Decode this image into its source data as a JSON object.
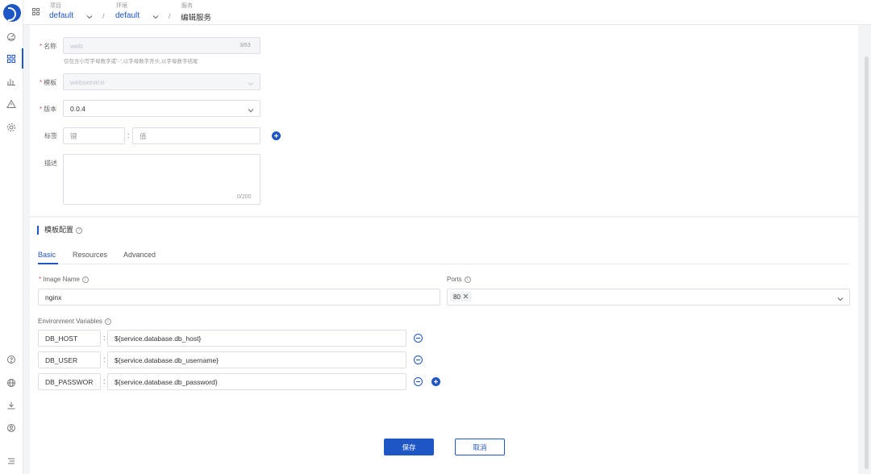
{
  "breadcrumb": {
    "project": {
      "caption": "项目",
      "value": "default"
    },
    "env": {
      "caption": "环境",
      "value": "default"
    },
    "service": {
      "caption": "服务",
      "value": "编辑服务"
    },
    "separator": "/"
  },
  "form": {
    "name": {
      "label": "名称",
      "value": "web",
      "counter": "3/63",
      "hint": "仅包含小写字母数字或\"-\",以字母数字开头,以字母数字结尾"
    },
    "template": {
      "label": "模板",
      "value": "webservice"
    },
    "version": {
      "label": "版本",
      "value": "0.0.4"
    },
    "tags": {
      "label": "标签",
      "key_placeholder": "键",
      "value_placeholder": "值",
      "colon": ":"
    },
    "description": {
      "label": "描述",
      "counter": "0/200"
    }
  },
  "template_config": {
    "title": "模板配置",
    "tabs": [
      "Basic",
      "Resources",
      "Advanced"
    ],
    "image_name": {
      "label": "Image Name",
      "value": "nginx"
    },
    "ports": {
      "label": "Ports",
      "tags": [
        "80"
      ]
    },
    "env_vars": {
      "label": "Environment Variables",
      "rows": [
        {
          "key": "DB_HOST",
          "value": "${service.database.db_host}"
        },
        {
          "key": "DB_USER",
          "value": "${service.database.db_username}"
        },
        {
          "key": "DB_PASSWOR",
          "value": "${service.database.db_password}"
        }
      ]
    }
  },
  "actions": {
    "save": "保存",
    "cancel": "取消"
  },
  "colors": {
    "primary": "#1f56c6",
    "required": "#e34d59"
  }
}
